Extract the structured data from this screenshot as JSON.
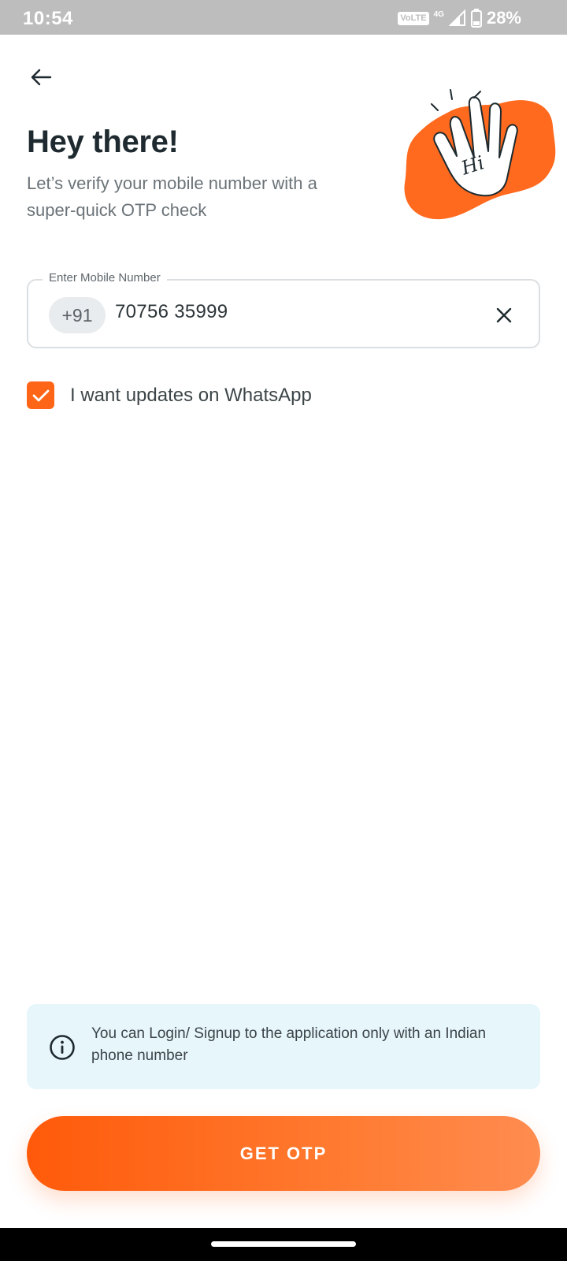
{
  "status_bar": {
    "time": "10:54",
    "volte": "VoLTE",
    "network": "4G",
    "battery": "28%"
  },
  "header": {
    "back_icon": "arrow-left-icon",
    "title": "Hey there!",
    "subtitle": "Let’s verify your mobile number with a super-quick OTP check",
    "illustration": "waving-hand-hi-icon",
    "illustration_text": "Hi"
  },
  "phone_field": {
    "label": "Enter Mobile Number",
    "country_code": "+91",
    "value": "70756 35999",
    "clear_icon": "close-icon"
  },
  "whatsapp_opt_in": {
    "checked": true,
    "label": "I want updates on WhatsApp"
  },
  "info_banner": {
    "icon": "info-icon",
    "text": "You can Login/ Signup to the application only with an Indian phone number"
  },
  "cta": {
    "label": "GET OTP"
  },
  "colors": {
    "accent": "#FF6516",
    "info_bg": "#E6F6FB",
    "status_bar": "#BDBDBD"
  }
}
